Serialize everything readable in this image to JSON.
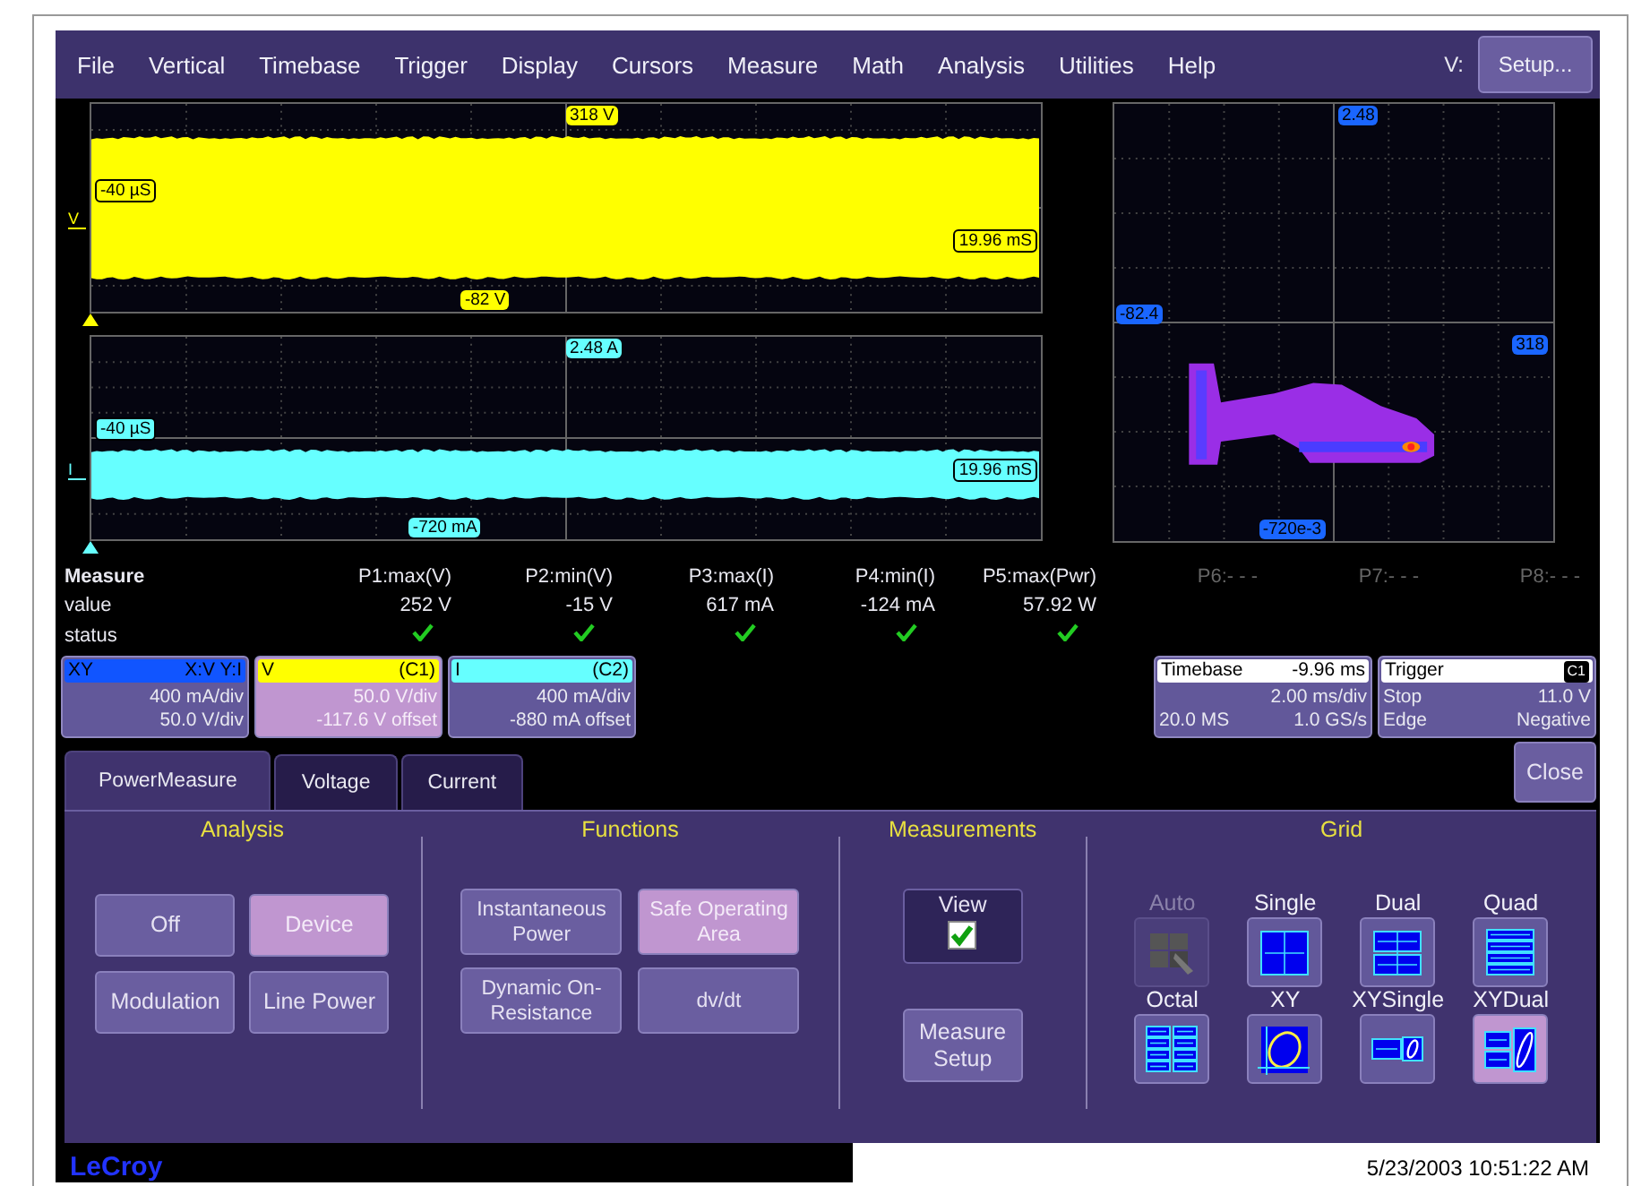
{
  "menu": {
    "items": [
      "File",
      "Vertical",
      "Timebase",
      "Trigger",
      "Display",
      "Cursors",
      "Measure",
      "Math",
      "Analysis",
      "Utilities",
      "Help"
    ],
    "v_label": "V:",
    "setup_button": "Setup..."
  },
  "traces": [
    {
      "kind": "voltage",
      "color": "#ffff00",
      "marker": "V",
      "top_label": "318 V",
      "bottom_label": "-82 V",
      "left_label": "-40 µS",
      "right_label": "19.96 mS"
    },
    {
      "kind": "current",
      "color": "#66ffff",
      "marker": "I",
      "top_label": "2.48 A",
      "bottom_label": "-720 mA",
      "left_label": "-40 µS",
      "right_label": "19.96 mS"
    }
  ],
  "xy_plot": {
    "top_label": "2.48",
    "left_label": "-82.4",
    "right_label": "318",
    "bottom_label": "-720e-3"
  },
  "measure": {
    "title": "Measure",
    "row_labels": [
      "value",
      "status"
    ],
    "params": [
      {
        "name": "P1:max(V)",
        "value": "252 V",
        "status": true
      },
      {
        "name": "P2:min(V)",
        "value": "-15 V",
        "status": true
      },
      {
        "name": "P3:max(I)",
        "value": "617 mA",
        "status": true
      },
      {
        "name": "P4:min(I)",
        "value": "-124 mA",
        "status": true
      },
      {
        "name": "P5:max(Pwr)",
        "value": "57.92 W",
        "status": true
      },
      {
        "name": "P6:- - -",
        "status": false
      },
      {
        "name": "P7:- - -",
        "status": false
      },
      {
        "name": "P8:- - -",
        "status": false
      }
    ]
  },
  "channels": [
    {
      "title": "XY",
      "tag": "X:V Y:I",
      "line1": "400 mA/div",
      "line2": "50.0 V/div",
      "color": "#1155ff",
      "selected": false
    },
    {
      "title": "V",
      "tag": "(C1)",
      "line1": "50.0 V/div",
      "line2": "-117.6 V offset",
      "color": "#ffff00",
      "selected": true
    },
    {
      "title": "I",
      "tag": "(C2)",
      "line1": "400 mA/div",
      "line2": "-880 mA offset",
      "color": "#66ffff",
      "selected": false
    }
  ],
  "timebase": {
    "title": "Timebase",
    "value": "-9.96 ms",
    "rows": [
      {
        "right": "2.00 ms/div"
      },
      {
        "left": "20.0 MS",
        "right": "1.0 GS/s"
      }
    ]
  },
  "trigger": {
    "title": "Trigger",
    "badge": "C1",
    "rows": [
      {
        "left": "Stop",
        "right": "11.0 V"
      },
      {
        "left": "Edge",
        "right": "Negative"
      }
    ]
  },
  "tabs": [
    {
      "label": "PowerMeasure",
      "selected": true
    },
    {
      "label": "Voltage",
      "selected": false
    },
    {
      "label": "Current",
      "selected": false
    }
  ],
  "close_button": "Close",
  "analysis": {
    "title": "Analysis",
    "buttons": [
      {
        "label": "Off",
        "selected": false
      },
      {
        "label": "Device",
        "selected": true
      },
      {
        "label": "Modulation",
        "selected": false
      },
      {
        "label": "Line Power",
        "selected": false
      }
    ]
  },
  "functions": {
    "title": "Functions",
    "buttons": [
      {
        "label": "Instantaneous Power",
        "selected": false
      },
      {
        "label": "Safe Operating Area",
        "selected": true
      },
      {
        "label": "Dynamic On-Resistance",
        "selected": false
      },
      {
        "label": "dv/dt",
        "selected": false
      }
    ]
  },
  "measurements": {
    "title": "Measurements",
    "view_label": "View",
    "view_checked": true,
    "setup_button": "Measure Setup"
  },
  "grid": {
    "title": "Grid",
    "items": [
      {
        "kind": "auto",
        "label": "Auto",
        "disabled": true,
        "selected": false
      },
      {
        "kind": "single",
        "label": "Single",
        "disabled": false,
        "selected": false
      },
      {
        "kind": "dual",
        "label": "Dual",
        "disabled": false,
        "selected": false
      },
      {
        "kind": "quad",
        "label": "Quad",
        "disabled": false,
        "selected": false
      },
      {
        "kind": "octal",
        "label": "Octal",
        "disabled": false,
        "selected": false
      },
      {
        "kind": "xy",
        "label": "XY",
        "disabled": false,
        "selected": false
      },
      {
        "kind": "xysingle",
        "label": "XYSingle",
        "disabled": false,
        "selected": false
      },
      {
        "kind": "xydual",
        "label": "XYDual",
        "disabled": false,
        "selected": true
      }
    ]
  },
  "footer": {
    "logo": "LeCroy",
    "timestamp": "5/23/2003 10:51:22 AM"
  }
}
